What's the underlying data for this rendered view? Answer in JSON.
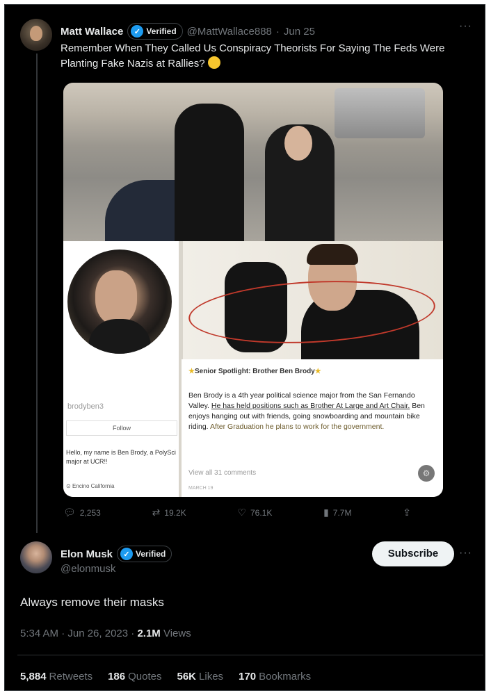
{
  "tweet1": {
    "name": "Matt Wallace",
    "verified_label": "Verified",
    "handle": "@MattWallace888",
    "dot": "·",
    "date": "Jun 25",
    "more": "···",
    "text": "Remember When They Called Us Conspiracy Theorists For Saying The Feds Were Planting Fake Nazis at Rallies?",
    "actions": {
      "replies": "2,253",
      "retweets": "19.2K",
      "likes": "76.1K",
      "views": "7.7M"
    }
  },
  "embedded": {
    "profile_handle": "brodyben3",
    "follow_label": "Follow",
    "bio": "Hello, my name is Ben Brody, a PolySci major at UCR!!",
    "location": "Encino California",
    "caption_title": "Senior Spotlight: Brother Ben Brody",
    "caption_part1": "Ben Brody is a 4th year political science major from the San Fernando Valley. ",
    "caption_part2": "He has held positions such as Brother At Large and Art Chair.",
    "caption_part3": " Ben enjoys hanging out with friends, going snowboarding and mountain bike riding. ",
    "caption_part4": "After Graduation he plans to work for the government.",
    "view_all": "View all 31 comments",
    "post_date": "MARCH 19"
  },
  "tweet2": {
    "name": "Elon Musk",
    "verified_label": "Verified",
    "handle": "@elonmusk",
    "subscribe_label": "Subscribe",
    "more": "···",
    "text": "Always remove their masks",
    "time": "5:34 AM · Jun 26, 2023 · ",
    "views_count": "2.1M",
    "views_label": " Views",
    "stats": {
      "retweets_count": "5,884",
      "retweets_label": "Retweets",
      "quotes_count": "186",
      "quotes_label": "Quotes",
      "likes_count": "56K",
      "likes_label": "Likes",
      "bookmarks_count": "170",
      "bookmarks_label": "Bookmarks"
    }
  },
  "icons": {
    "reply": "reply-icon",
    "retweet": "retweet-icon",
    "like": "heart-icon",
    "views": "views-icon",
    "share": "share-icon",
    "verified": "verified-badge-icon"
  },
  "colors": {
    "background": "#000000",
    "verified_blue": "#1d9bf0",
    "muted": "#71767b",
    "text": "#e7e9ea",
    "annotation_red": "#c0392b"
  }
}
